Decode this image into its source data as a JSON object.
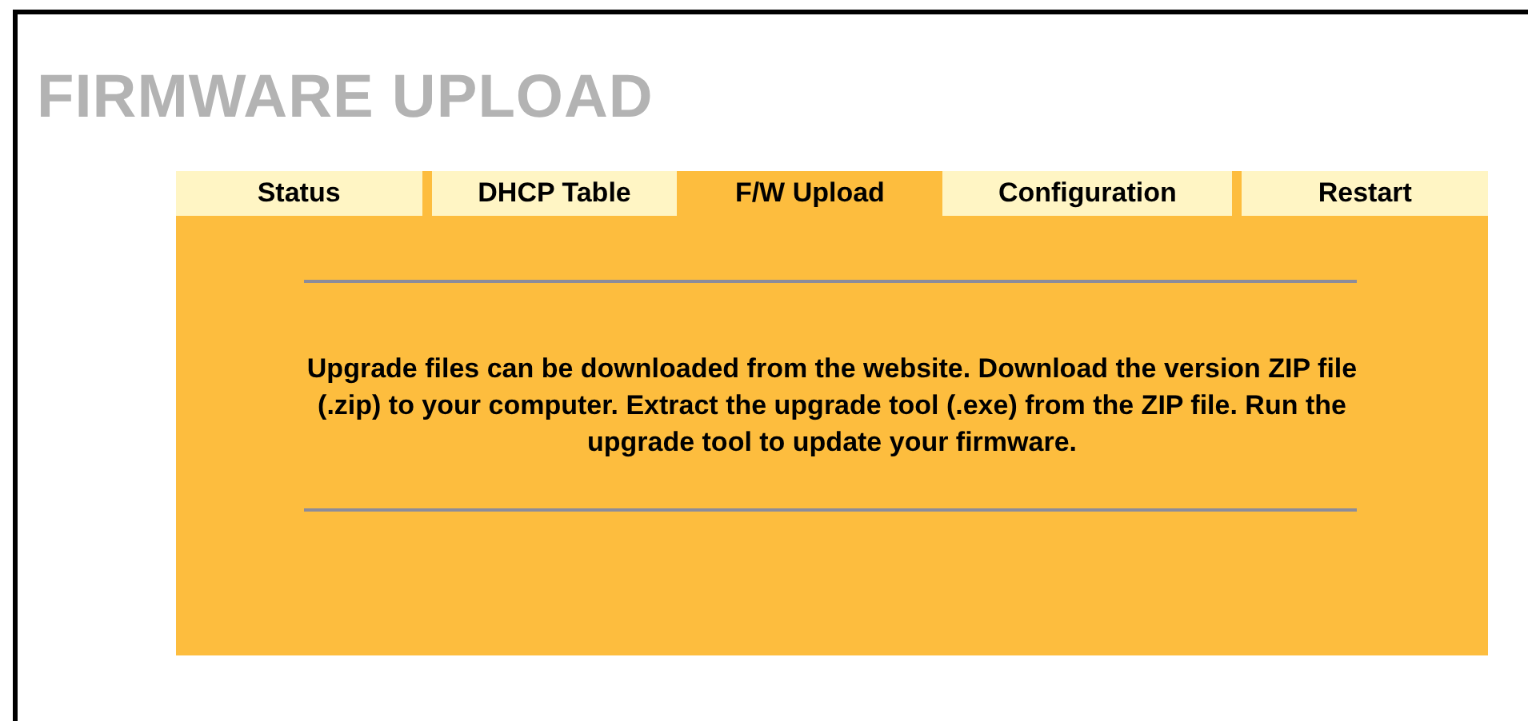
{
  "page_title": "FIRMWARE UPLOAD",
  "tabs": [
    {
      "label": "Status",
      "selected": false
    },
    {
      "label": "DHCP Table",
      "selected": false
    },
    {
      "label": "F/W Upload",
      "selected": true
    },
    {
      "label": "Configuration",
      "selected": false
    },
    {
      "label": "Restart",
      "selected": false
    }
  ],
  "message": "Upgrade files can be downloaded from the website. Download the version ZIP file (.zip) to your computer. Extract the upgrade tool (.exe) from the ZIP file. Run the upgrade tool to update your firmware."
}
